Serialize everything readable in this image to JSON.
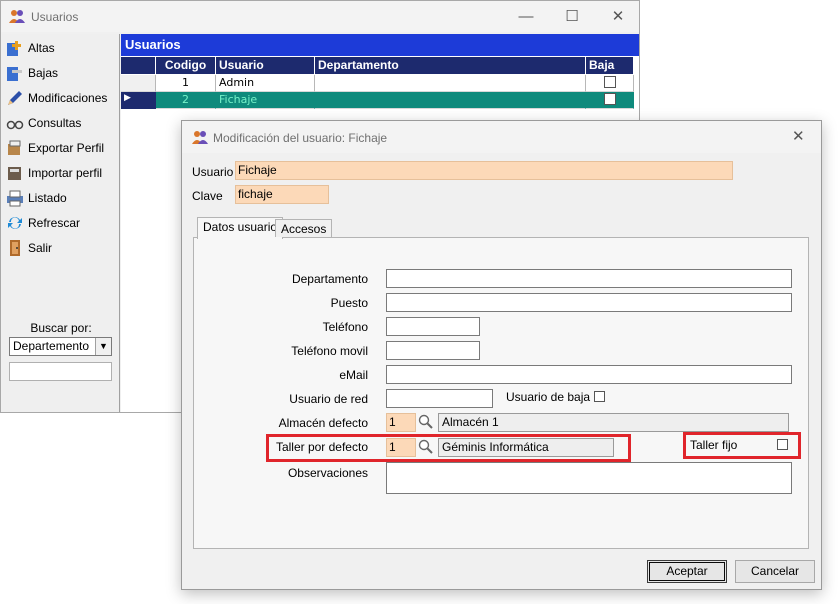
{
  "main_window": {
    "title": "Usuarios",
    "toolbar": [
      {
        "label": "Altas",
        "icon": "add-user-icon"
      },
      {
        "label": "Bajas",
        "icon": "remove-user-icon"
      },
      {
        "label": "Modificaciones",
        "icon": "pencil-icon"
      },
      {
        "label": "Consultas",
        "icon": "glasses-icon"
      },
      {
        "label": "Exportar Perfil",
        "icon": "export-icon"
      },
      {
        "label": "Importar perfil",
        "icon": "import-icon"
      },
      {
        "label": "Listado",
        "icon": "printer-icon"
      },
      {
        "label": "Refrescar",
        "icon": "refresh-icon"
      },
      {
        "label": "Salir",
        "icon": "exit-door-icon"
      }
    ],
    "search": {
      "label": "Buscar por:",
      "selected": "Departemento",
      "value": ""
    },
    "grid": {
      "title": "Usuarios",
      "columns": [
        "Codigo",
        "Usuario",
        "Departamento",
        "Baja"
      ],
      "rows": [
        {
          "codigo": "1",
          "usuario": "Admin",
          "departamento": "",
          "baja": false
        },
        {
          "codigo": "2",
          "usuario": "Fichaje",
          "departamento": "",
          "baja": false,
          "selected": true
        }
      ]
    }
  },
  "dialog": {
    "title": "Modificación del usuario: Fichaje",
    "usuario_label": "Usuario",
    "usuario_value": "Fichaje",
    "clave_label": "Clave",
    "clave_value": "fichaje",
    "tabs": [
      "Datos usuario",
      "Accesos"
    ],
    "fields": {
      "departamento": {
        "label": "Departamento",
        "value": ""
      },
      "puesto": {
        "label": "Puesto",
        "value": ""
      },
      "telefono": {
        "label": "Teléfono",
        "value": ""
      },
      "telefono_movil": {
        "label": "Teléfono movil",
        "value": ""
      },
      "email": {
        "label": "eMail",
        "value": ""
      },
      "usuario_red": {
        "label": "Usuario de red",
        "value": ""
      },
      "usuario_baja": {
        "label": "Usuario de baja",
        "checked": false
      },
      "almacen": {
        "label": "Almacén defecto",
        "code": "1",
        "name": "Almacén 1"
      },
      "taller": {
        "label": "Taller por defecto",
        "code": "1",
        "name": "Géminis Informática"
      },
      "taller_fijo": {
        "label": "Taller fijo",
        "checked": false
      },
      "observaciones": {
        "label": "Observaciones",
        "value": ""
      }
    },
    "buttons": {
      "ok": "Aceptar",
      "cancel": "Cancelar"
    },
    "highlight_color": "#e0252b"
  }
}
